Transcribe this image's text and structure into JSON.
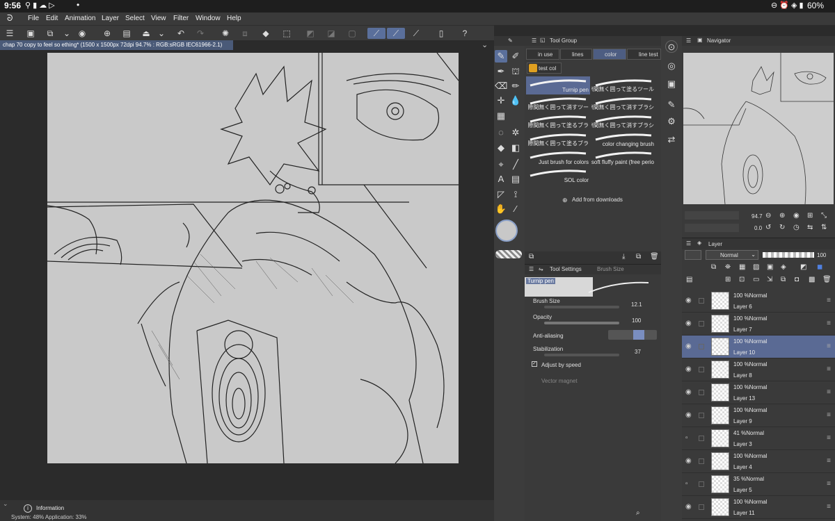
{
  "status": {
    "time": "9:56",
    "dot": "•",
    "battery": "60%"
  },
  "menu": [
    "File",
    "Edit",
    "Animation",
    "Layer",
    "Select",
    "View",
    "Filter",
    "Window",
    "Help"
  ],
  "document": {
    "title": "chap 70 copy to feel so ething* (1500 x 1500px 72dpi 94.7% : RGB:sRGB IEC61966-2.1)"
  },
  "tool_group": {
    "panel_title": "Tool Group",
    "tabs": [
      "in use",
      "lines",
      "color",
      "line test"
    ],
    "subgroup": "test col",
    "brushes": [
      "Turnip pen",
      "隙間無く囲って塗るツール",
      "隙間無く囲って消すツー",
      "隙間無く囲って消すブラシ",
      "隙間無く囲って塗るブラ",
      "隙間無く囲って消すブラシ",
      "隙間無く囲って塗るブラ",
      "color changing brush",
      "Just brush for colors",
      "soft fluffy paint (free perio",
      "SOL color"
    ],
    "add_label": "Add from downloads"
  },
  "tool_settings": {
    "panel_title": "Tool Settings",
    "tab2": "Brush Size",
    "preset": "Turnip pen",
    "brush_size_label": "Brush Size",
    "brush_size_value": "12.1",
    "opacity_label": "Opacity",
    "opacity_value": "100",
    "antialiasing_label": "Anti-aliasing",
    "stabilization_label": "Stabilization",
    "stabilization_value": "37",
    "adjust_label": "Adjust by speed",
    "vector_label": "Vector magnet"
  },
  "navigator": {
    "panel_title": "Navigator",
    "zoom": "94.7",
    "rotation": "0.0"
  },
  "layers": {
    "panel_title": "Layer",
    "blend": "Normal",
    "opacity": "100",
    "items": [
      {
        "mode": "100 %Normal",
        "name": "Layer 6"
      },
      {
        "mode": "100 %Normal",
        "name": "Layer 7"
      },
      {
        "mode": "100 %Normal",
        "name": "Layer 10"
      },
      {
        "mode": "100 %Normal",
        "name": "Layer 8"
      },
      {
        "mode": "100 %Normal",
        "name": "Layer 13"
      },
      {
        "mode": "100 %Normal",
        "name": "Layer 9"
      },
      {
        "mode": "41 %Normal",
        "name": "Layer 3"
      },
      {
        "mode": "100 %Normal",
        "name": "Layer 4"
      },
      {
        "mode": "35 %Normal",
        "name": "Layer 5"
      },
      {
        "mode": "100 %Normal",
        "name": "Layer 11"
      }
    ]
  },
  "info": {
    "label": "Information",
    "status": "System: 48%  Application: 33%"
  },
  "colors": {
    "accent": "#5a6a94",
    "canvas": "#c9c9c9"
  }
}
